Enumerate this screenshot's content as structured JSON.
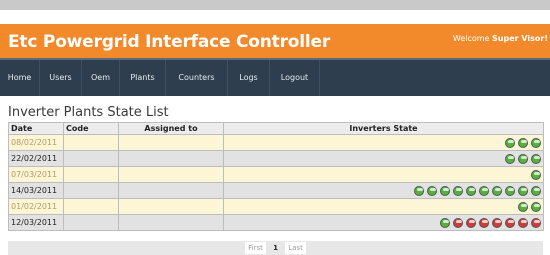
{
  "header": {
    "title": "Etc Powergrid Interface Controller",
    "welcome_prefix": "Welcome",
    "user": "Super Visor!"
  },
  "nav": [
    {
      "label": "Home"
    },
    {
      "label": "Users"
    },
    {
      "label": "Oem"
    },
    {
      "label": "Plants"
    },
    {
      "label": "Counters"
    },
    {
      "label": "Logs"
    },
    {
      "label": "Logout"
    }
  ],
  "page": {
    "title": "Inverter Plants State List"
  },
  "table": {
    "columns": [
      "Date",
      "Code",
      "Assigned to",
      "Inverters State"
    ],
    "rows": [
      {
        "date": "08/02/2011",
        "code": "",
        "assigned": "",
        "states": [
          "green",
          "green",
          "green"
        ]
      },
      {
        "date": "22/02/2011",
        "code": "",
        "assigned": "",
        "states": [
          "green",
          "green",
          "green"
        ]
      },
      {
        "date": "07/03/2011",
        "code": "",
        "assigned": "",
        "states": [
          "green"
        ]
      },
      {
        "date": "14/03/2011",
        "code": "",
        "assigned": "",
        "states": [
          "green",
          "green",
          "green",
          "green",
          "green",
          "green",
          "green",
          "green",
          "green",
          "green"
        ]
      },
      {
        "date": "01/02/2011",
        "code": "",
        "assigned": "",
        "states": [
          "green",
          "green"
        ]
      },
      {
        "date": "12/03/2011",
        "code": "",
        "assigned": "",
        "states": [
          "green",
          "red",
          "red",
          "red",
          "red",
          "red",
          "red",
          "red"
        ]
      }
    ]
  },
  "pager": {
    "first": "First",
    "current": "1",
    "last": "Last"
  },
  "colors": {
    "header_bg": "#f28a2b",
    "nav_bg": "#2e3e4f",
    "row_odd": "#fdf6d6",
    "row_even": "#e2e2e2",
    "led_green": "#52b33c",
    "led_red": "#d23a3a"
  }
}
